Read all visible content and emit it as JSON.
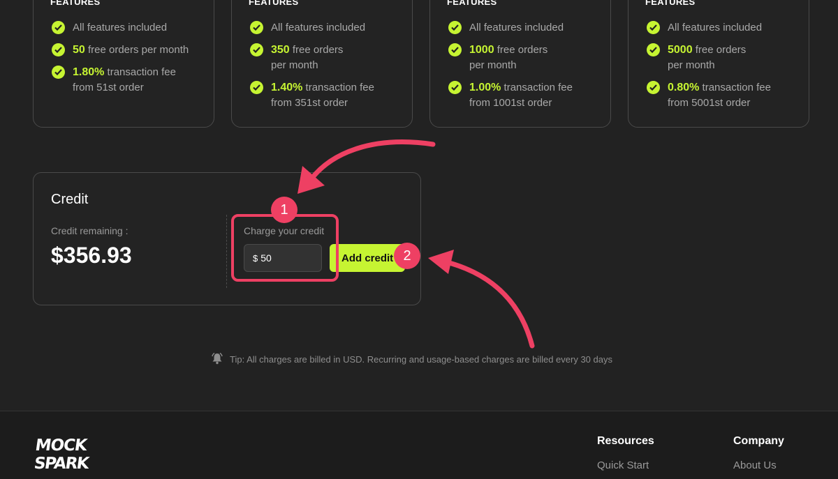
{
  "plans": [
    {
      "features_title": "FEATURES",
      "items": [
        {
          "highlight": "",
          "text": "All features included",
          "text2": ""
        },
        {
          "highlight": "50",
          "text": " free orders per month",
          "text2": ""
        },
        {
          "highlight": "1.80%",
          "text": " transaction fee",
          "text2": "from 51st order"
        }
      ]
    },
    {
      "features_title": "FEATURES",
      "items": [
        {
          "highlight": "",
          "text": "All features included",
          "text2": ""
        },
        {
          "highlight": "350",
          "text": " free orders",
          "text2": "per month"
        },
        {
          "highlight": "1.40%",
          "text": " transaction fee",
          "text2": "from 351st order"
        }
      ]
    },
    {
      "features_title": "FEATURES",
      "items": [
        {
          "highlight": "",
          "text": "All features included",
          "text2": ""
        },
        {
          "highlight": "1000",
          "text": " free orders",
          "text2": "per month"
        },
        {
          "highlight": "1.00%",
          "text": " transaction fee",
          "text2": "from 1001st order"
        }
      ]
    },
    {
      "features_title": "FEATURES",
      "items": [
        {
          "highlight": "",
          "text": "All features included",
          "text2": ""
        },
        {
          "highlight": "5000",
          "text": " free orders",
          "text2": "per month"
        },
        {
          "highlight": "0.80%",
          "text": " transaction fee",
          "text2": "from 5001st order"
        }
      ]
    }
  ],
  "credit": {
    "title": "Credit",
    "remaining_label": "Credit remaining :",
    "remaining_amount": "$356.93",
    "charge_label": "Charge your credit",
    "currency_symbol": "$",
    "charge_value": "50",
    "add_button": "Add credit"
  },
  "annotations": {
    "badge1": "1",
    "badge2": "2"
  },
  "tip": {
    "icon": "bell-icon",
    "text": "Tip: All charges are billed in USD. Recurring and usage-based charges are billed every 30 days"
  },
  "footer": {
    "logo_line1": "MOCK",
    "logo_line2": "SPARK",
    "columns": [
      {
        "title": "Resources",
        "link": "Quick Start"
      },
      {
        "title": "Company",
        "link": "About Us"
      }
    ]
  },
  "colors": {
    "accent": "#c6f432",
    "annotation": "#ee4063",
    "background": "#222222"
  }
}
